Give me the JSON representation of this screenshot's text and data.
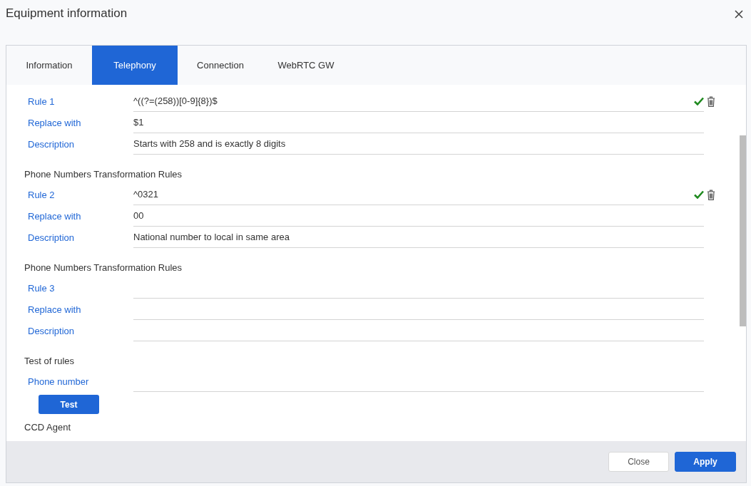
{
  "window": {
    "title": "Equipment information"
  },
  "tabs": [
    {
      "label": "Information",
      "selected": false
    },
    {
      "label": "Telephony",
      "selected": true
    },
    {
      "label": "Connection",
      "selected": false
    },
    {
      "label": "WebRTC GW",
      "selected": false
    }
  ],
  "rules": [
    {
      "fields": [
        {
          "label": "Rule 1",
          "value": "^((?=(258))[0-9]{8})$",
          "valid": true,
          "deletable": true
        },
        {
          "label": "Replace with",
          "value": "$1"
        },
        {
          "label": "Description",
          "value": "Starts with 258 and is exactly 8 digits"
        }
      ]
    },
    {
      "heading": "Phone Numbers Transformation Rules",
      "fields": [
        {
          "label": "Rule 2",
          "value": "^0321",
          "valid": true,
          "deletable": true
        },
        {
          "label": "Replace with",
          "value": "00"
        },
        {
          "label": "Description",
          "value": "National number to local in same area"
        }
      ]
    },
    {
      "heading": "Phone Numbers Transformation Rules",
      "fields": [
        {
          "label": "Rule 3"
        },
        {
          "label": "Replace with"
        },
        {
          "label": "Description"
        }
      ]
    }
  ],
  "test": {
    "heading": "Test of rules",
    "field": {
      "label": "Phone number"
    },
    "button": "Test"
  },
  "next_section": {
    "heading": "CCD Agent"
  },
  "footer": {
    "buttons": [
      {
        "label": "Close",
        "kind": "secondary"
      },
      {
        "label": "Apply",
        "kind": "primary"
      }
    ]
  }
}
